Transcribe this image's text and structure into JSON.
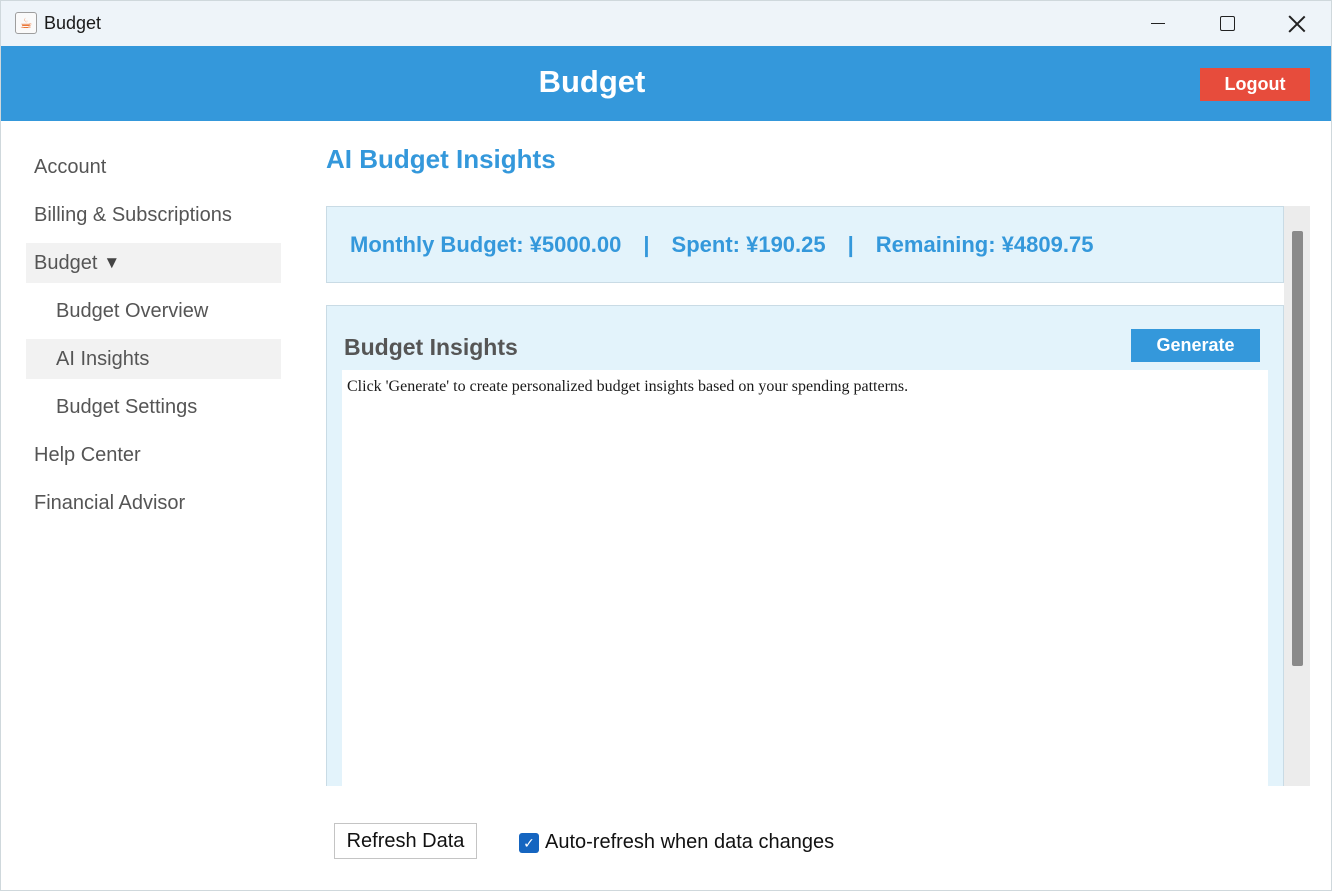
{
  "window": {
    "title": "Budget"
  },
  "header": {
    "title": "Budget",
    "logout_label": "Logout"
  },
  "sidebar": {
    "items": [
      {
        "label": "Account"
      },
      {
        "label": "Billing & Subscriptions"
      },
      {
        "label": "Budget",
        "caret": "▼"
      },
      {
        "label": "Budget Overview"
      },
      {
        "label": "AI Insights"
      },
      {
        "label": "Budget Settings"
      },
      {
        "label": "Help Center"
      },
      {
        "label": "Financial Advisor"
      }
    ]
  },
  "main": {
    "title": "AI Budget Insights",
    "summary": {
      "monthly_budget": "Monthly Budget: ¥5000.00",
      "spent": "Spent: ¥190.25",
      "remaining": "Remaining: ¥4809.75",
      "separator": "|"
    },
    "insights": {
      "title": "Budget Insights",
      "generate_label": "Generate",
      "text": "Click 'Generate' to create personalized budget insights based on your spending patterns."
    }
  },
  "footer": {
    "refresh_label": "Refresh Data",
    "auto_refresh_label": "Auto-refresh when data changes",
    "auto_refresh_checked": true
  },
  "colors": {
    "accent": "#3498db",
    "logout": "#e74c3c",
    "panel_bg": "#e3f3fb",
    "checkbox": "#1565c0"
  }
}
